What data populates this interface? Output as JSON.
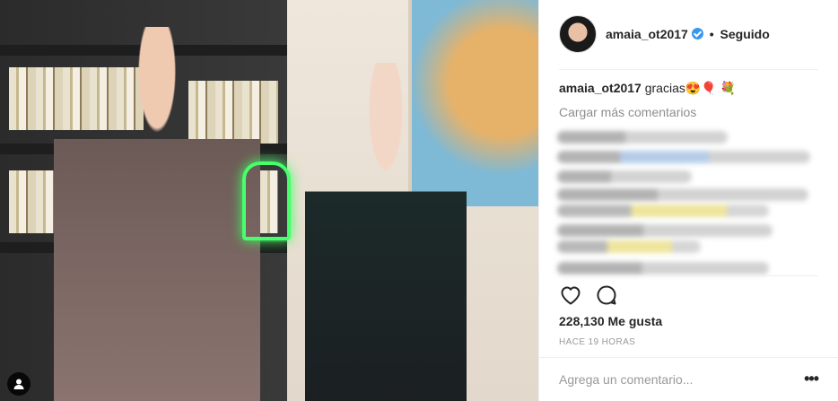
{
  "post": {
    "photo_label": "Post photo",
    "username": "amaia_ot2017",
    "follow_status": "Seguido",
    "separator": "•",
    "caption_user": "amaia_ot2017",
    "caption_text": "gracias😍🎈 💐",
    "load_more": "Cargar más comentarios",
    "likes": "228,130 Me gusta",
    "timestamp": "HACE 19 HORAS",
    "comment_placeholder": "Agrega un comentario...",
    "more_options": "•••"
  },
  "icons": {
    "verified": "verified-badge-icon",
    "like": "heart-icon",
    "comment": "comment-icon",
    "tag": "user-tag-icon"
  },
  "colors": {
    "verified": "#3897f0",
    "neon": "#46ff6c",
    "muted": "#8e8e8e"
  }
}
